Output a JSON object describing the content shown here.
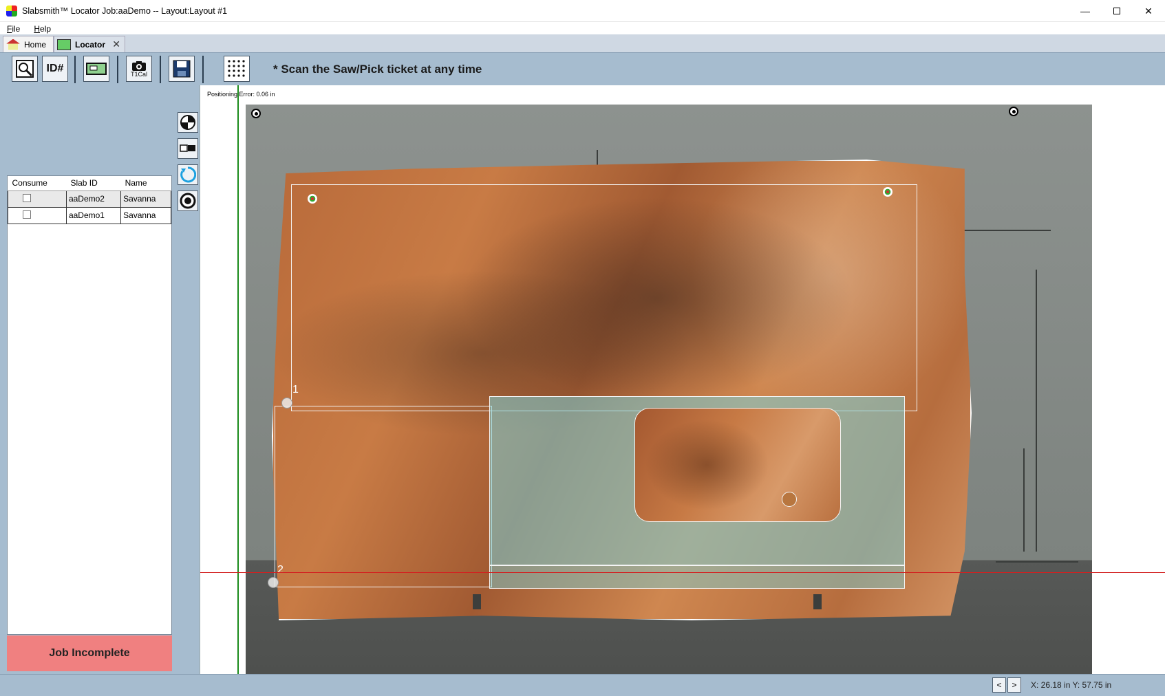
{
  "window": {
    "title": "Slabsmith™ Locator Job:aaDemo -- Layout:Layout #1"
  },
  "menu": {
    "items": [
      {
        "label": "File",
        "ul": "F",
        "rest": "ile"
      },
      {
        "label": "Help",
        "ul": "H",
        "rest": "elp"
      }
    ]
  },
  "tabs": {
    "home": "Home",
    "locator": "Locator",
    "close_glyph": "✕"
  },
  "toolbar": {
    "buttons": [
      {
        "name": "slab-search-icon"
      },
      {
        "name": "id-icon"
      },
      {
        "name": "layout-icon"
      },
      {
        "name": "camera-icon",
        "label": "T1Cal"
      },
      {
        "name": "save-icon"
      },
      {
        "name": "grid-dots-icon"
      }
    ],
    "id_glyph": "ID#",
    "scan_message": "* Scan the Saw/Pick ticket at any time"
  },
  "slab_table": {
    "columns": [
      "Consume",
      "Slab ID",
      "Name"
    ],
    "rows": [
      {
        "consume": false,
        "slab_id": "aaDemo2",
        "name": "Savanna"
      },
      {
        "consume": false,
        "slab_id": "aaDemo1",
        "name": "Savanna"
      }
    ]
  },
  "side_tools": [
    {
      "name": "target-quarter-icon"
    },
    {
      "name": "toggle-view-icon"
    },
    {
      "name": "rotate-icon"
    },
    {
      "name": "target-ring-icon"
    }
  ],
  "status": {
    "job_status": "Job Incomplete",
    "positioning_error": "Positioning Error: 0.06 in",
    "coordinates": "X: 26.18 in  Y: 57.75 in",
    "prev": "<",
    "next": ">"
  },
  "layout": {
    "vertex_labels": [
      "1",
      "2"
    ]
  },
  "colors": {
    "accent_panel": "#a6bccf",
    "job_incomplete_bg": "#f08080",
    "cut_region": "#7dcdd2",
    "guide_green": "#1a8a1a",
    "guide_red": "#d32020"
  }
}
